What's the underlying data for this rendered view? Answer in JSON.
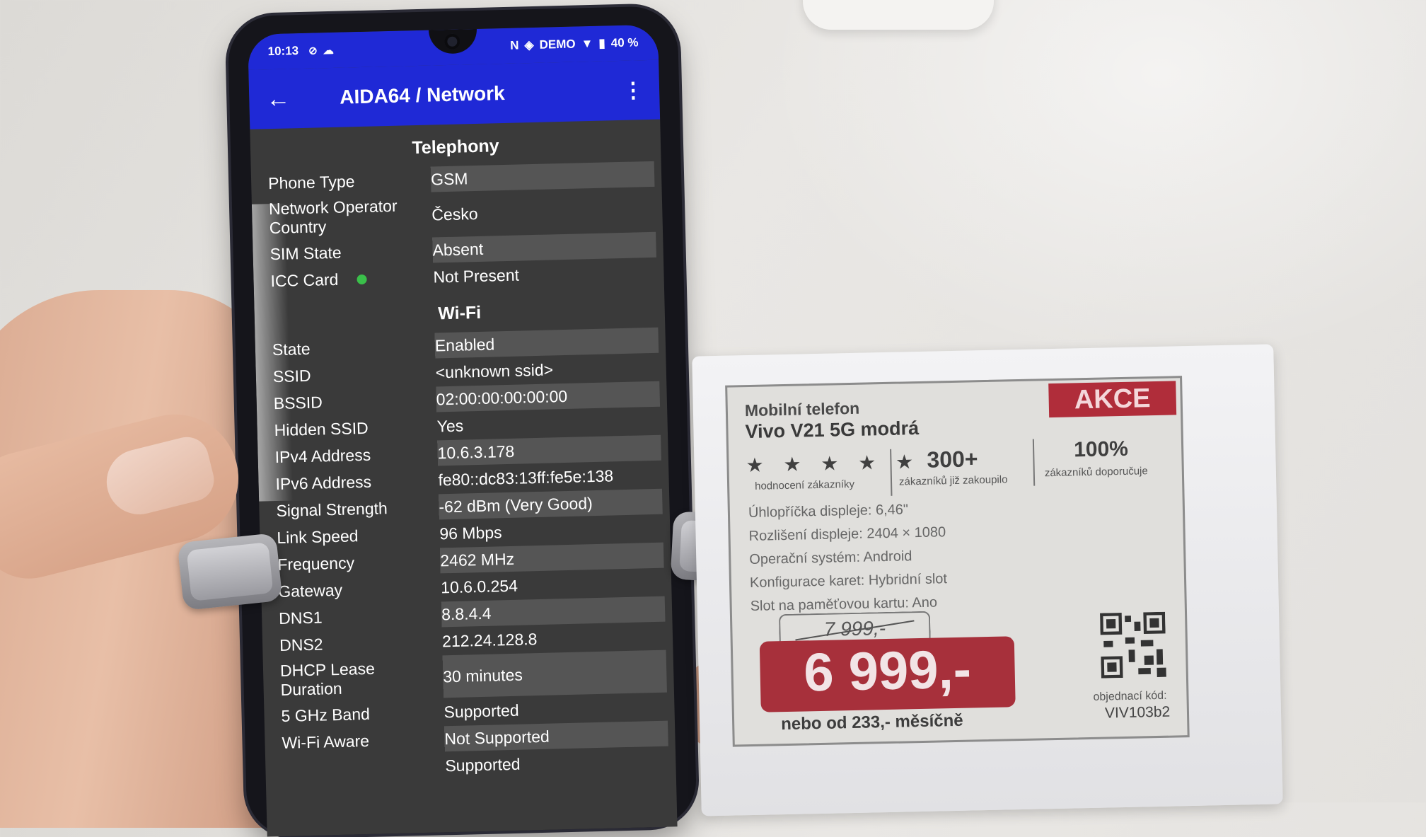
{
  "status_bar": {
    "time": "10:13",
    "carrier": "DEMO",
    "battery": "40 %"
  },
  "app_bar": {
    "title": "AIDA64  /  Network"
  },
  "telephony": {
    "title": "Telephony",
    "rows": [
      {
        "key": "Phone Type",
        "value": "GSM"
      },
      {
        "key": "Network Operator Country",
        "value": "Česko"
      },
      {
        "key": "SIM State",
        "value": "Absent"
      },
      {
        "key": "ICC Card",
        "value": "Not Present"
      }
    ]
  },
  "wifi": {
    "title": "Wi-Fi",
    "rows": [
      {
        "key": "State",
        "value": "Enabled"
      },
      {
        "key": "SSID",
        "value": "<unknown ssid>"
      },
      {
        "key": "BSSID",
        "value": "02:00:00:00:00:00"
      },
      {
        "key": "Hidden SSID",
        "value": "Yes"
      },
      {
        "key": "IPv4 Address",
        "value": "10.6.3.178"
      },
      {
        "key": "IPv6 Address",
        "value": "fe80::dc83:13ff:fe5e:138"
      },
      {
        "key": "Signal Strength",
        "value": "-62 dBm (Very Good)"
      },
      {
        "key": "Link Speed",
        "value": "96 Mbps"
      },
      {
        "key": "Frequency",
        "value": "2462 MHz"
      },
      {
        "key": "Gateway",
        "value": "10.6.0.254"
      },
      {
        "key": "DNS1",
        "value": "8.8.4.4"
      },
      {
        "key": "DNS2",
        "value": "212.24.128.8"
      },
      {
        "key": "DHCP Lease Duration",
        "value": "30 minutes"
      },
      {
        "key": "5 GHz Band",
        "value": "Supported"
      },
      {
        "key": "Wi-Fi Aware",
        "value": "Not Supported"
      },
      {
        "key": "",
        "value": "Supported"
      }
    ]
  },
  "price_tag": {
    "badge": "AKCE",
    "category": "Mobilní telefon",
    "product": "Vivo V21 5G modrá",
    "stars": "★ ★ ★ ★ ★",
    "stars_label": "hodnocení zákazníky",
    "stat1_value": "300+",
    "stat1_label": "zákazníků již zakoupilo",
    "stat2_value": "100%",
    "stat2_label": "zákazníků doporučuje",
    "specs": [
      "Úhlopříčka displeje: 6,46\"",
      "Rozlišení displeje: 2404 × 1080",
      "Operační systém: Android",
      "Konfigurace karet: Hybridní slot",
      "Slot na paměťovou kartu: Ano"
    ],
    "old_price": "7 999,-",
    "price": "6 999,-",
    "monthly": "nebo od 233,- měsíčně",
    "order_label": "objednací kód:",
    "order_code": "VIV103b2"
  }
}
